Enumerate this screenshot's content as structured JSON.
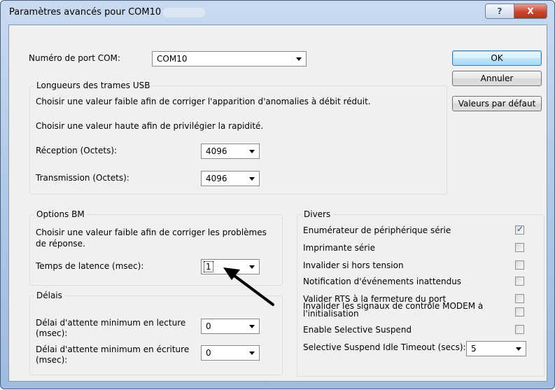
{
  "window": {
    "title": "Paramètres avancés pour COM10",
    "help_glyph": "?",
    "close_glyph": "X"
  },
  "port": {
    "label": "Numéro de port COM:",
    "value": "COM10"
  },
  "buttons": {
    "ok": "OK",
    "cancel": "Annuler",
    "defaults": "Valeurs par défaut"
  },
  "usb": {
    "legend": "Longueurs des trames USB",
    "hint_low": "Choisir une valeur faible afin de corriger  l'apparition d'anomalies à débit réduit.",
    "hint_high": "Choisir une valeur haute afin de privilégier la rapidité.",
    "rx_label": "Réception (Octets):",
    "rx_value": "4096",
    "tx_label": "Transmission (Octets):",
    "tx_value": "4096"
  },
  "bm": {
    "legend": "Options BM",
    "hint": "Choisir une valeur faible afin de corriger les problèmes de réponse.",
    "latency_label": "Temps de latence (msec):",
    "latency_value": "1"
  },
  "timeouts": {
    "legend": "Délais",
    "read_label": "Délai d'attente minimum en lecture (msec):",
    "read_value": "0",
    "write_label": "Délai d'attente minimum en écriture (msec):",
    "write_value": "0"
  },
  "misc": {
    "legend": "Divers",
    "items": [
      {
        "label": "Enumérateur de périphérique série",
        "checked": true
      },
      {
        "label": "Imprimante série",
        "checked": false
      },
      {
        "label": "Invalider si hors tension",
        "checked": false
      },
      {
        "label": "Notification d'événements inattendus",
        "checked": false
      },
      {
        "label": "Valider RTS à la fermeture du port",
        "checked": false
      },
      {
        "label": "Invalider les signaux de contrôle MODEM à l'initialisation",
        "checked": false
      },
      {
        "label": "Enable Selective Suspend",
        "checked": false
      }
    ],
    "suspend_label": "Selective Suspend Idle Timeout (secs):",
    "suspend_value": "5",
    "check_glyph": "✓"
  },
  "colors": {
    "arrow": "#000000",
    "titlebar": "#b4cbe8",
    "close": "#c8452d"
  }
}
